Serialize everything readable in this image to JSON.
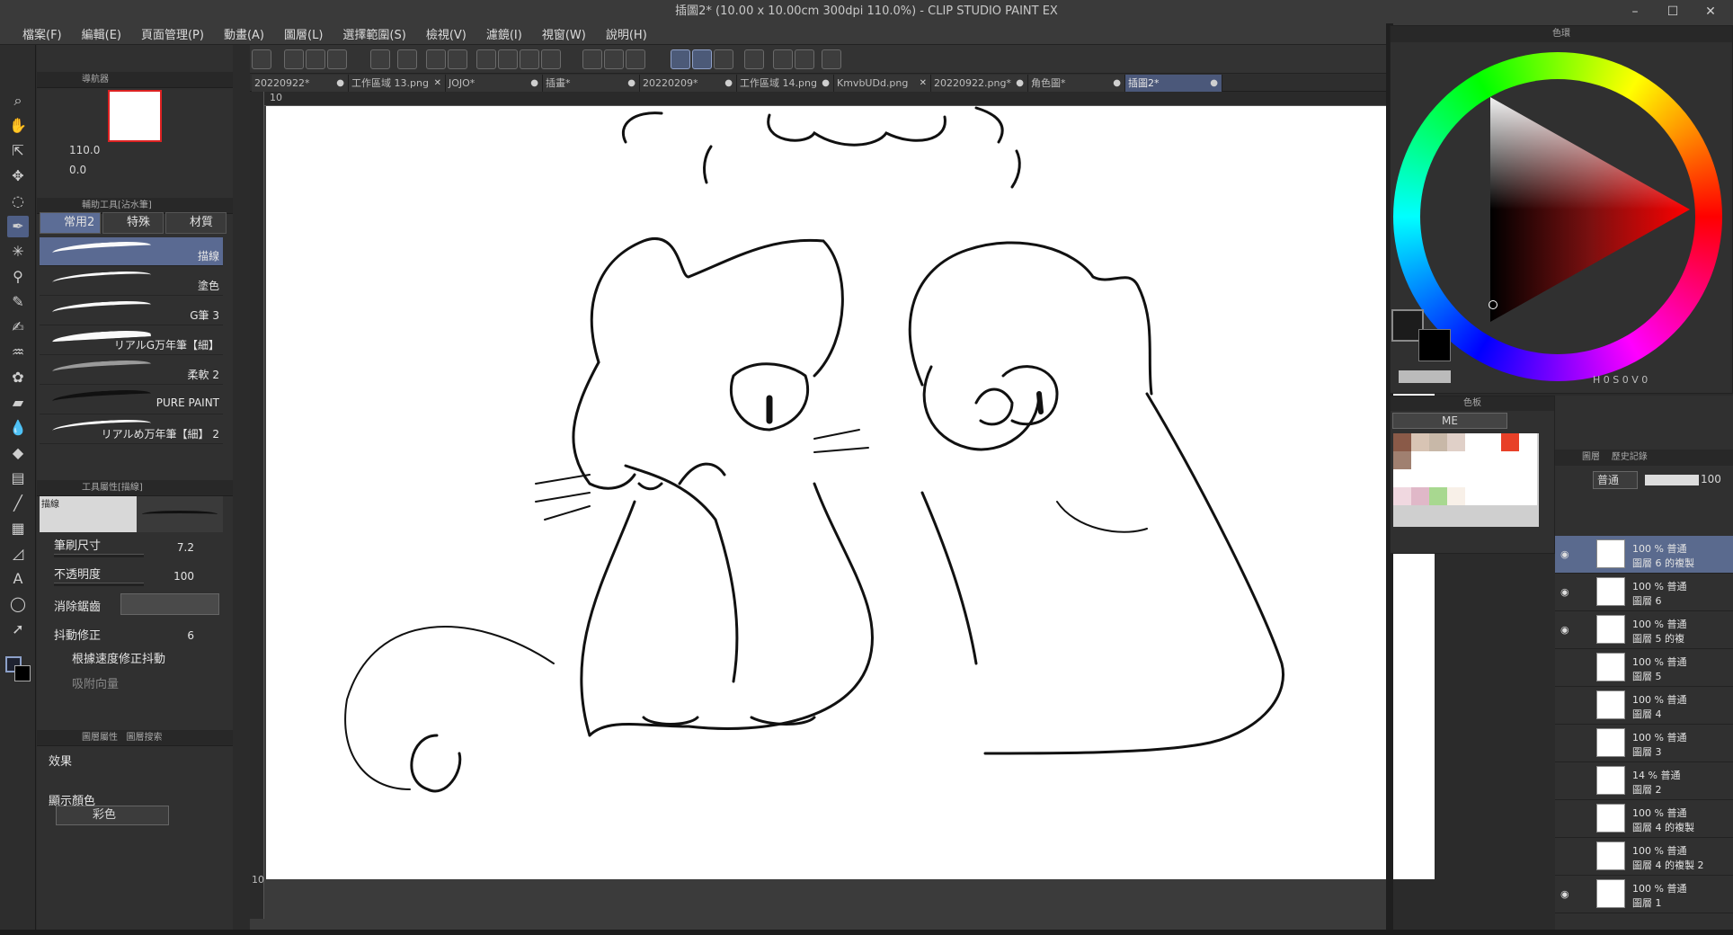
{
  "window": {
    "title": "插圖2* (10.00 x 10.00cm 300dpi 110.0%)  - CLIP STUDIO PAINT EX",
    "min": "–",
    "max": "☐",
    "close": "✕"
  },
  "menu": [
    "檔案(F)",
    "編輯(E)",
    "頁面管理(P)",
    "動畫(A)",
    "圖層(L)",
    "選擇範圍(S)",
    "檢視(V)",
    "濾鏡(I)",
    "視窗(W)",
    "說明(H)"
  ],
  "tabs": [
    {
      "label": "20220922*",
      "close": "●"
    },
    {
      "label": "工作區域 13.png",
      "close": "✕"
    },
    {
      "label": "JOJO*",
      "close": "●"
    },
    {
      "label": "插畫*",
      "close": "●"
    },
    {
      "label": "20220209*",
      "close": "●"
    },
    {
      "label": "工作區域 14.png",
      "close": "●"
    },
    {
      "label": "KmvbUDd.png",
      "close": "✕"
    },
    {
      "label": "20220922.png*",
      "close": "●"
    },
    {
      "label": "角色圖*",
      "close": "●"
    },
    {
      "label": "插圖2*",
      "close": "●"
    }
  ],
  "ruler": {
    "top_mark": "10",
    "left_mark": "10"
  },
  "navigator": {
    "title": "導航器",
    "zoom": "110.0",
    "rotation": "0.0"
  },
  "subtool": {
    "title": "輔助工具[沾水筆]",
    "tabs": [
      "常用2",
      "特殊",
      "材質"
    ],
    "brushes": [
      "描線",
      "塗色",
      "G筆 3",
      "リアルG万年筆【細】",
      "柔軟 2",
      "PURE PAINT",
      "リアルめ万年筆【細】 2"
    ]
  },
  "tool_property": {
    "title": "工具屬性[描線]",
    "preview_label": "描線",
    "brush_size_label": "筆刷尺寸",
    "brush_size_value": "7.2",
    "opacity_label": "不透明度",
    "opacity_value": "100",
    "antialias_label": "消除鋸齒",
    "stabilization_label": "抖動修正",
    "stabilization_value": "6",
    "speed_label": "根據速度修正抖動",
    "vector_label": "吸附向量"
  },
  "layer_property": {
    "title": "圖層屬性",
    "title2": "圖層搜索",
    "effect_label": "效果",
    "display_color_label": "顯示顏色",
    "display_color_value": "彩色"
  },
  "color_panel": {
    "title": "色環",
    "readout": "H 0  S 0  V 0",
    "accent": "#ff0000"
  },
  "swatch": {
    "title": "色板",
    "set_name": "ME",
    "colors": [
      "#8a5a48",
      "#d8c4b4",
      "#c8b8a8",
      "#e0d0c8",
      "#ffffff",
      "#ffffff",
      "#e84028",
      "#ffffff",
      "#a08070",
      "#ffffff",
      "#ffffff",
      "#ffffff",
      "#ffffff",
      "#ffffff",
      "#ffffff",
      "#ffffff",
      "#ffffff",
      "#ffffff",
      "#ffffff",
      "#ffffff",
      "#ffffff",
      "#ffffff",
      "#ffffff",
      "#ffffff",
      "#f0d8e0",
      "#e0b8c8",
      "#a8d890",
      "#f8f0e8",
      "#ffffff",
      "#ffffff",
      "#ffffff",
      "#ffffff"
    ]
  },
  "layers": {
    "tabs": [
      "圖層",
      "歷史記錄"
    ],
    "blend_mode": "普通",
    "opacity": "100",
    "items": [
      {
        "pct": "100 % 普通",
        "name": "圖層 6 的複製",
        "active": true,
        "visible": true
      },
      {
        "pct": "100 % 普通",
        "name": "圖層 6",
        "active": false,
        "visible": true
      },
      {
        "pct": "100 % 普通",
        "name": "圖層 5 的複",
        "active": false,
        "visible": true
      },
      {
        "pct": "100 % 普通",
        "name": "圖層 5",
        "active": false,
        "visible": false
      },
      {
        "pct": "100 % 普通",
        "name": "圖層 4",
        "active": false,
        "visible": false
      },
      {
        "pct": "100 % 普通",
        "name": "圖層 3",
        "active": false,
        "visible": false
      },
      {
        "pct": "14 % 普通",
        "name": "圖層 2",
        "active": false,
        "visible": false
      },
      {
        "pct": "100 % 普通",
        "name": "圖層 4 的複製",
        "active": false,
        "visible": false
      },
      {
        "pct": "100 % 普通",
        "name": "圖層 4 的複製 2",
        "active": false,
        "visible": false
      },
      {
        "pct": "100 % 普通",
        "name": "圖層 1",
        "active": false,
        "visible": true
      }
    ]
  }
}
